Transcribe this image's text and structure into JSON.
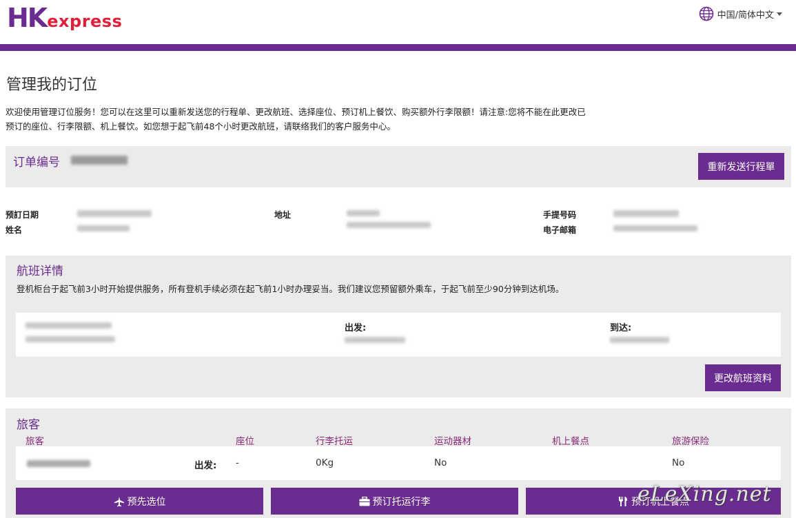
{
  "header": {
    "logo_hk": "HK",
    "logo_express": "express",
    "language": "中国/简体中文",
    "colors": {
      "brand_purple": "#6b2c91",
      "brand_red": "#e0203a"
    }
  },
  "page": {
    "title": "管理我的订位",
    "intro_line1": "欢迎使用管理订位服务！您可以在这里可以重新发送您的行程单、更改航班、选择座位、预订机上餐饮、购买额外行李限额！请注意:您将不能在此更改已",
    "intro_line2": "预订的座位、行李限额、机上餐饮。如您想于起飞前48个小时更改航班，请联络我们的客户服务中心。"
  },
  "booking": {
    "ref_label": "订单编号",
    "resend_button": "重新发送行程單"
  },
  "info": {
    "booking_date_label": "预訂日期",
    "name_label": "姓名",
    "address_label": "地址",
    "mobile_label": "手提号码",
    "email_label": "电子邮箱"
  },
  "flight": {
    "title": "航班详情",
    "note": "登机柜台于起飞前3小时开始提供服务，所有登机手续必须在起飞前1小时办理妥当。我们建议您预留额外乘车，于起飞前至少90分钟到达机场。",
    "depart_label": "出发:",
    "arrive_label": "到达:",
    "change_button": "更改航班资料"
  },
  "passengers": {
    "title": "旅客",
    "columns": [
      "旅客",
      "座位",
      "行李托运",
      "运动器材",
      "机上餐点",
      "旅游保险"
    ],
    "row": {
      "direction": "出发:",
      "seat": "-",
      "baggage": "0Kg",
      "sports": "No",
      "meal": "",
      "insurance": "No"
    }
  },
  "actions": {
    "seat_button": "预先选位",
    "baggage_button": "预订托运行李",
    "meal_button": "预订机上餐点"
  },
  "watermark": "eLeXing.net"
}
